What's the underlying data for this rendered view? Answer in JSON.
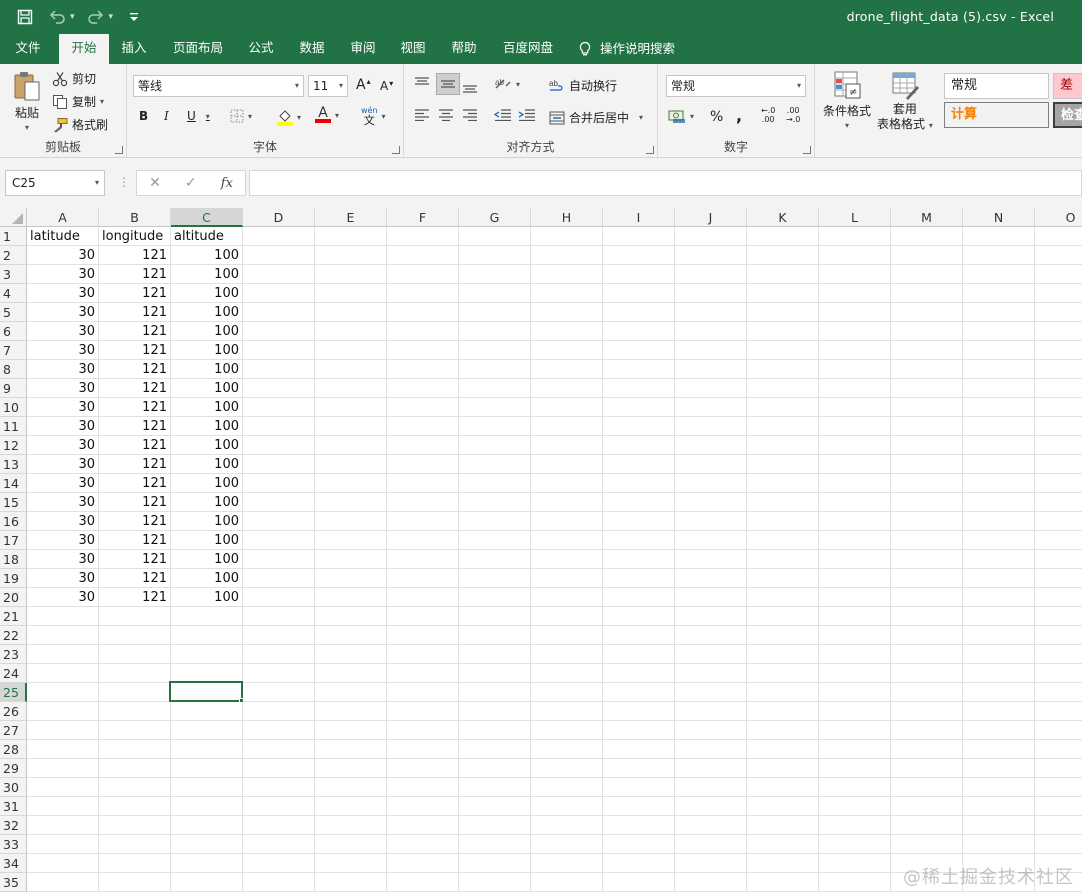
{
  "window": {
    "title": "drone_flight_data (5).csv  -  Excel"
  },
  "theme": {
    "accent": "#217346",
    "ribbon_bg": "#f3f3f3"
  },
  "quick_access": [
    {
      "icon": "save-icon"
    },
    {
      "icon": "undo-icon"
    },
    {
      "icon": "redo-icon"
    },
    {
      "icon": "customize-qat-icon"
    }
  ],
  "tabs": [
    {
      "label": "文件",
      "active": false
    },
    {
      "label": "开始",
      "active": true
    },
    {
      "label": "插入",
      "active": false
    },
    {
      "label": "页面布局",
      "active": false
    },
    {
      "label": "公式",
      "active": false
    },
    {
      "label": "数据",
      "active": false
    },
    {
      "label": "审阅",
      "active": false
    },
    {
      "label": "视图",
      "active": false
    },
    {
      "label": "帮助",
      "active": false
    },
    {
      "label": "百度网盘",
      "active": false
    }
  ],
  "tell_me": "操作说明搜索",
  "ribbon": {
    "clipboard": {
      "label": "剪贴板",
      "paste": "粘贴",
      "cut": "剪切",
      "copy": "复制",
      "format_painter": "格式刷"
    },
    "font": {
      "label": "字体",
      "font_name": "等线",
      "font_size": "11",
      "bold": "B",
      "italic": "I",
      "underline": "U",
      "grow": "A",
      "shrink": "A",
      "font_color_letter": "A",
      "phonetic": "wén",
      "phonetic_char": "文"
    },
    "alignment": {
      "label": "对齐方式",
      "wrap_text": "自动换行",
      "merge_center": "合并后居中"
    },
    "number": {
      "label": "数字",
      "format": "常规",
      "percent": "%",
      "comma": ",",
      "inc_decimal_top": "←.0",
      "inc_decimal_bottom": ".00",
      "dec_decimal_top": ".00",
      "dec_decimal_bottom": "→.0"
    },
    "styles": {
      "conditional": "条件格式",
      "table_format_1": "套用",
      "table_format_2": "表格格式",
      "normal": "常规",
      "bad": "差",
      "calculation": "计算",
      "check": "检查"
    }
  },
  "formula_bar": {
    "name_box": "C25",
    "fx": "fx",
    "content": ""
  },
  "grid": {
    "columns": [
      "A",
      "B",
      "C",
      "D",
      "E",
      "F",
      "G",
      "H",
      "I",
      "J",
      "K",
      "L",
      "M",
      "N",
      "O"
    ],
    "row_count": 35,
    "selected_cell": "C25",
    "headers": [
      "latitude",
      "longitude",
      "altitude"
    ],
    "rows": [
      [
        30,
        121,
        100
      ],
      [
        30,
        121,
        100
      ],
      [
        30,
        121,
        100
      ],
      [
        30,
        121,
        100
      ],
      [
        30,
        121,
        100
      ],
      [
        30,
        121,
        100
      ],
      [
        30,
        121,
        100
      ],
      [
        30,
        121,
        100
      ],
      [
        30,
        121,
        100
      ],
      [
        30,
        121,
        100
      ],
      [
        30,
        121,
        100
      ],
      [
        30,
        121,
        100
      ],
      [
        30,
        121,
        100
      ],
      [
        30,
        121,
        100
      ],
      [
        30,
        121,
        100
      ],
      [
        30,
        121,
        100
      ],
      [
        30,
        121,
        100
      ],
      [
        30,
        121,
        100
      ],
      [
        30,
        121,
        100
      ]
    ]
  },
  "watermark": "@稀土掘金技术社区"
}
